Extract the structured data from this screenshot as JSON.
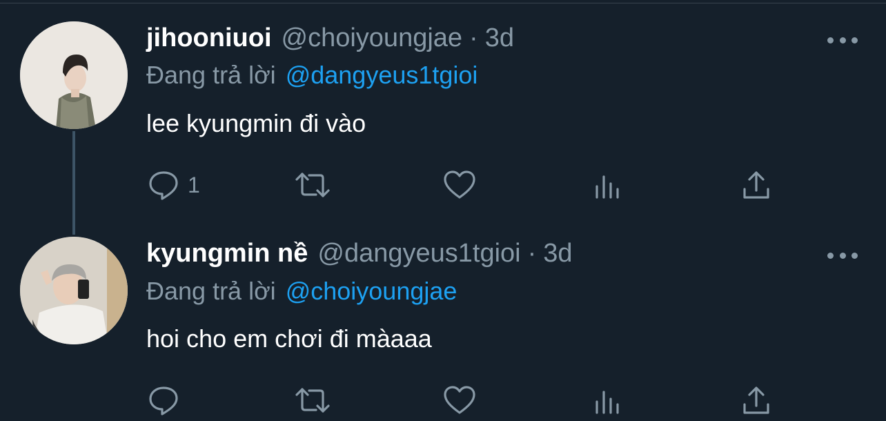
{
  "tweets": [
    {
      "display_name": "jihooniuoi",
      "handle": "@choiyoungjae",
      "separator": "·",
      "time": "3d",
      "reply_prefix": "Đang trả lời",
      "reply_to": "@dangyeus1tgioi",
      "text": "lee kyungmin đi vào",
      "reply_count": "1",
      "icons": [
        "reply-icon",
        "retweet-icon",
        "like-icon",
        "analytics-icon",
        "share-icon",
        "more-icon"
      ]
    },
    {
      "display_name": "kyungmin nề",
      "handle": "@dangyeus1tgioi",
      "separator": "·",
      "time": "3d",
      "reply_prefix": "Đang trả lời",
      "reply_to": "@choiyoungjae",
      "text": "hoi cho em chơi đi màaaa",
      "reply_count": "",
      "icons": [
        "reply-icon",
        "retweet-icon",
        "like-icon",
        "analytics-icon",
        "share-icon",
        "more-icon"
      ]
    }
  ],
  "colors": {
    "background": "#15202b",
    "text_primary": "#ffffff",
    "text_secondary": "#8899a6",
    "mention": "#1da1f2",
    "thread_line": "#3d5466"
  }
}
